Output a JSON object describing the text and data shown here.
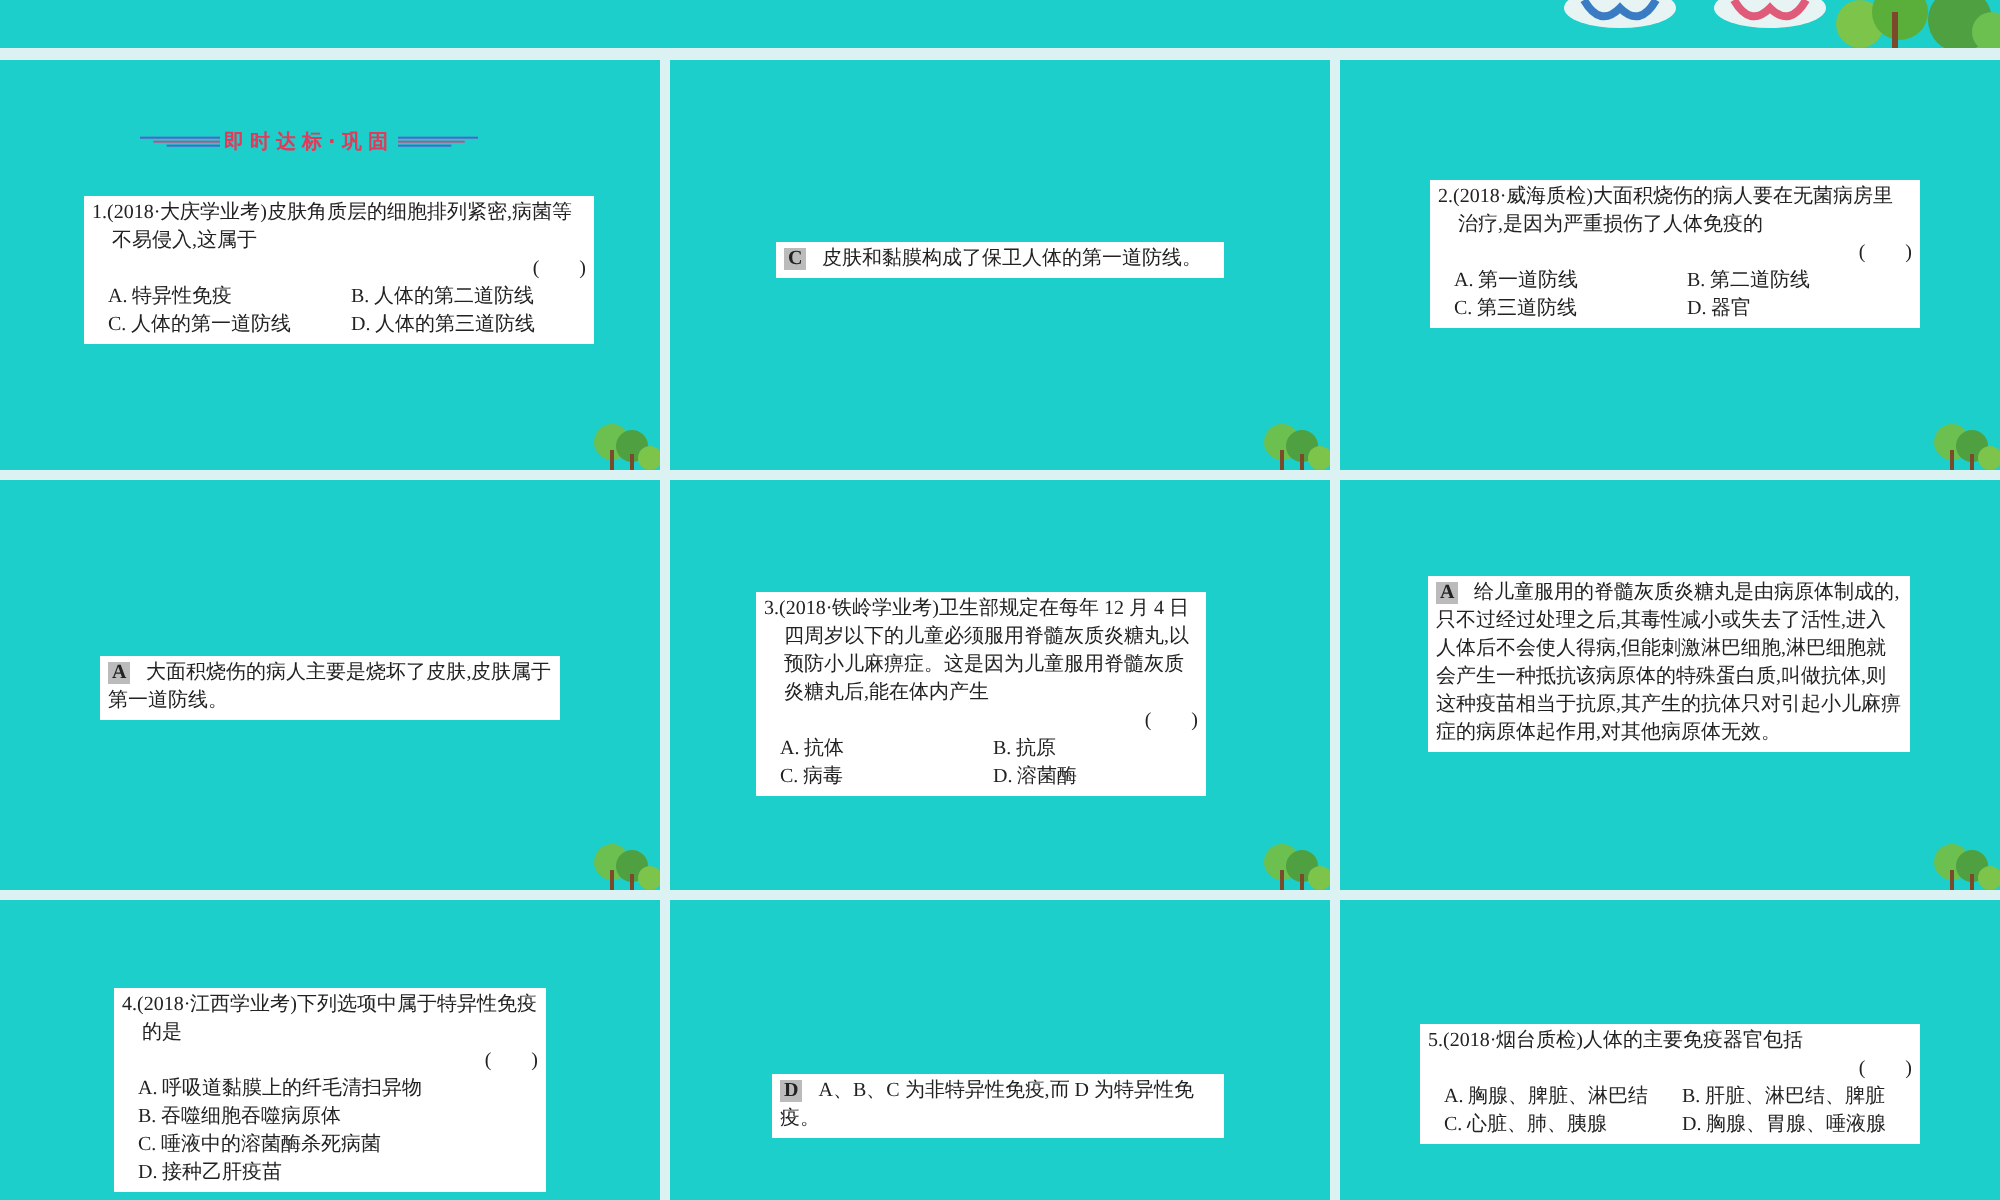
{
  "slides": [
    {
      "kind": "question",
      "header": "即时达标·巩固",
      "stem": "1.(2018·大庆学业考)皮肤角质层的细胞排列紧密,病菌等不易侵入,这属于",
      "bracket": "(　　)",
      "options": [
        "A. 特异性免疫",
        "B. 人体的第二道防线",
        "C. 人体的第一道防线",
        "D. 人体的第三道防线"
      ]
    },
    {
      "kind": "answer",
      "letter": "C",
      "text": "皮肤和黏膜构成了保卫人体的第一道防线。"
    },
    {
      "kind": "question",
      "stem": "2.(2018·威海质检)大面积烧伤的病人要在无菌病房里治疗,是因为严重损伤了人体免疫的",
      "bracket": "(　　)",
      "options": [
        "A. 第一道防线",
        "B. 第二道防线",
        "C. 第三道防线",
        "D. 器官"
      ]
    },
    {
      "kind": "answer",
      "letter": "A",
      "text": "大面积烧伤的病人主要是烧坏了皮肤,皮肤属于第一道防线。"
    },
    {
      "kind": "question",
      "stem": "3.(2018·铁岭学业考)卫生部规定在每年 12 月 4 日四周岁以下的儿童必须服用脊髓灰质炎糖丸,以预防小儿麻痹症。这是因为儿童服用脊髓灰质炎糖丸后,能在体内产生",
      "bracket": "(　　)",
      "options": [
        "A. 抗体",
        "B. 抗原",
        "C. 病毒",
        "D. 溶菌酶"
      ]
    },
    {
      "kind": "answer",
      "letter": "A",
      "text": "给儿童服用的脊髓灰质炎糖丸是由病原体制成的,只不过经过处理之后,其毒性减小或失去了活性,进入人体后不会使人得病,但能刺激淋巴细胞,淋巴细胞就会产生一种抵抗该病原体的特殊蛋白质,叫做抗体,则这种疫苗相当于抗原,其产生的抗体只对引起小儿麻痹症的病原体起作用,对其他病原体无效。"
    },
    {
      "kind": "question",
      "stem": "4.(2018·江西学业考)下列选项中属于特异性免疫的是",
      "bracket": "(　　)",
      "options": [
        "A. 呼吸道黏膜上的纤毛清扫异物",
        "B. 吞噬细胞吞噬病原体",
        "C. 唾液中的溶菌酶杀死病菌",
        "D. 接种乙肝疫苗"
      ]
    },
    {
      "kind": "answer",
      "letter": "D",
      "text": "A、B、C 为非特异性免疫,而 D 为特异性免疫。"
    },
    {
      "kind": "question",
      "stem": "5.(2018·烟台质检)人体的主要免疫器官包括",
      "bracket": "(　　)",
      "options": [
        "A. 胸腺、脾脏、淋巴结",
        "B. 肝脏、淋巴结、脾脏",
        "C. 心脏、肺、胰腺",
        "D. 胸腺、胃腺、唾液腺"
      ]
    }
  ]
}
